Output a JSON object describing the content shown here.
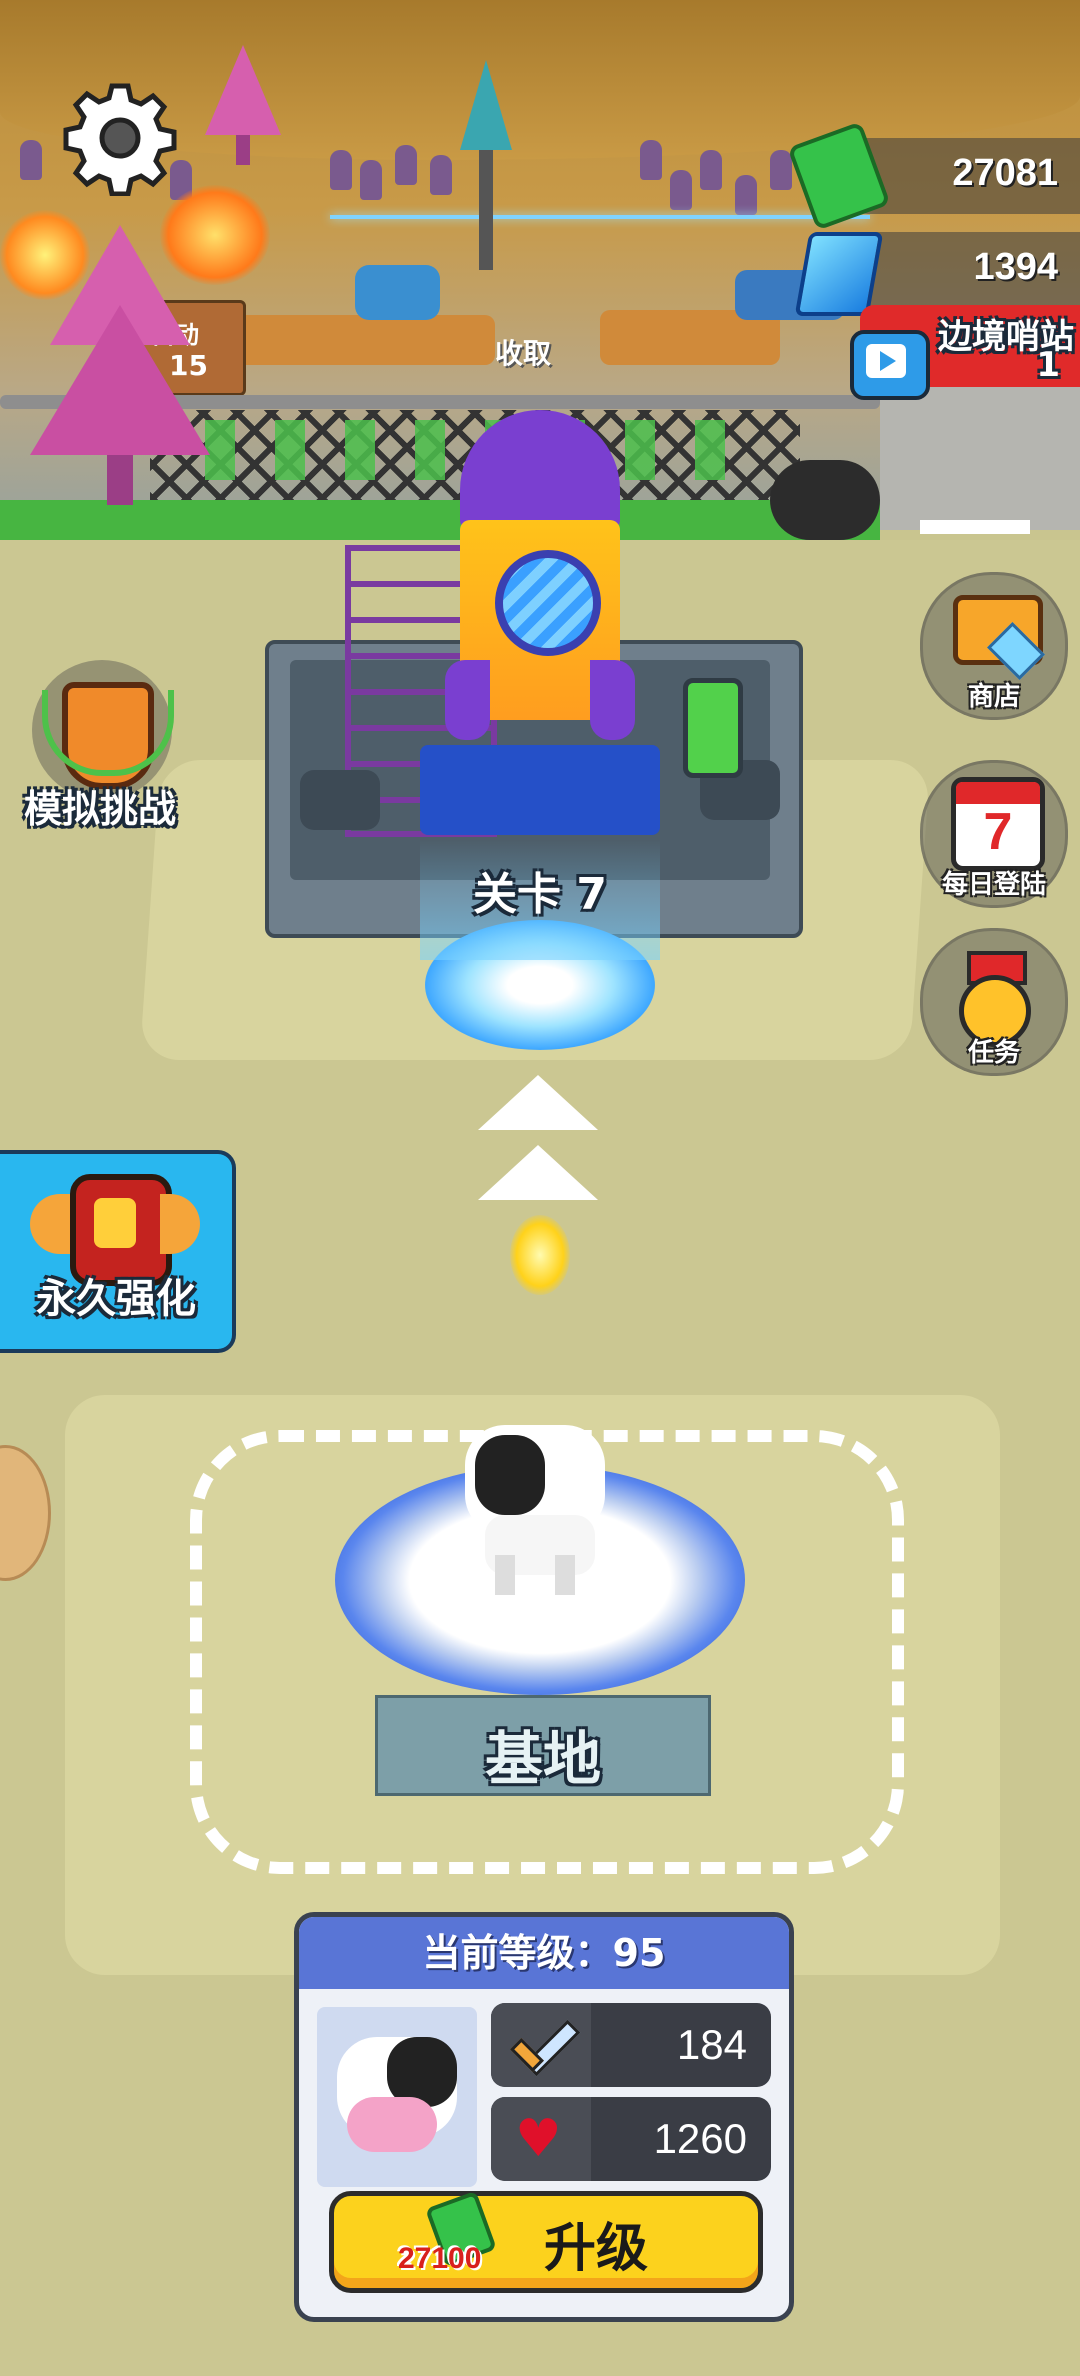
{
  "currency": {
    "cash": "27081",
    "gems": "1394"
  },
  "top_banner": {
    "title": "边境哨站",
    "count": "1"
  },
  "battlefield": {
    "collect_label": "收取",
    "left_sign_text": "自动",
    "left_sign_num": "15"
  },
  "left_buttons": {
    "sim_challenge": "模拟挑战",
    "permanent_boost": "永久强化"
  },
  "right_buttons": {
    "shop": "商店",
    "daily_login": "每日登陆",
    "daily_login_day": "7",
    "tasks": "任务"
  },
  "level_portal": {
    "label": "关卡 7"
  },
  "base": {
    "label": "基地"
  },
  "upgrade_panel": {
    "header": "当前等级：95",
    "attack": "184",
    "health": "1260",
    "button_label": "升级",
    "cost": "27100"
  },
  "colors": {
    "ground": "#cbc792",
    "grass": "#47b541",
    "panel_header": "#5975d6",
    "upgrade_button": "#fcd21d",
    "cost_text": "#d8201c",
    "portal": "#55b8ff"
  }
}
